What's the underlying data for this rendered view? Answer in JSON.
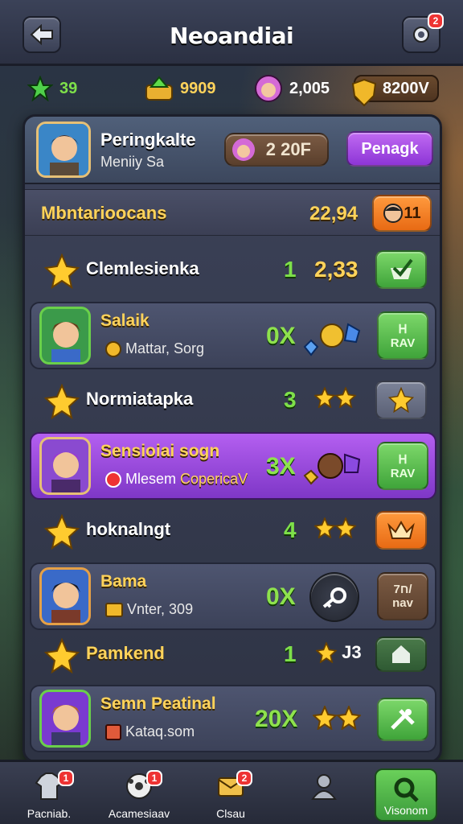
{
  "header": {
    "title": "Neoandiai",
    "notif_badge": "2"
  },
  "currencies": [
    {
      "value": "39",
      "icon": "green-star-icon"
    },
    {
      "value": "9909",
      "icon": "gem-chest-icon"
    },
    {
      "value": "2,005",
      "icon": "avatar-icon"
    },
    {
      "value": "8200V",
      "icon": "gold-shield-icon"
    }
  ],
  "profile": {
    "name": "Peringkalte",
    "subtitle": "Meniiy Sa",
    "pill": "2 20F",
    "button": "Penagk"
  },
  "title_row": {
    "label": "Mbntarioocans",
    "value": "22,94",
    "badge": "11"
  },
  "rows": [
    {
      "kind": "plain",
      "label": "Clemlesienka",
      "num": "1",
      "value": "2,33",
      "btn": "green"
    },
    {
      "kind": "card",
      "name": "Salaik",
      "sub": "Mattar, Sorg",
      "mult": "0X",
      "btn_top": "ᕼ",
      "btn": "RAV",
      "style": "normal"
    },
    {
      "kind": "plain",
      "label": "Normiatapka",
      "num": "3",
      "btn": "grey"
    },
    {
      "kind": "card",
      "name": "Sensioiai sogn",
      "sub_a": "Mlesem",
      "sub_b": "CopericaV",
      "mult": "3X",
      "btn_top": "ᕼ",
      "btn": "RAV",
      "style": "purple"
    },
    {
      "kind": "plain",
      "label": "hoknalngt",
      "num": "4",
      "btn": "orange"
    },
    {
      "kind": "card",
      "name": "Bama",
      "sub": "Vnter, 309",
      "mult": "0X",
      "btn_top": "ח7/",
      "btn": "nav",
      "style": "normal"
    },
    {
      "kind": "plain",
      "label": "Pamkend",
      "num": "1",
      "value": "J3",
      "btn": "darkgreen"
    },
    {
      "kind": "card",
      "name": "Semn Peatinal",
      "sub": "Kataq.som",
      "mult": "20X",
      "style": "normal"
    }
  ],
  "tabs": [
    {
      "label": "Pacniab.",
      "badge": "1"
    },
    {
      "label": "Acamesiaav",
      "badge": "1"
    },
    {
      "label": "Clsau",
      "badge": "2"
    },
    {
      "label": "",
      "badge": ""
    },
    {
      "label": "Visonom",
      "badge": ""
    }
  ],
  "colors": {
    "accent_green": "#7ee04a",
    "gold": "#ffd35b",
    "purple": "#b45ff0"
  }
}
